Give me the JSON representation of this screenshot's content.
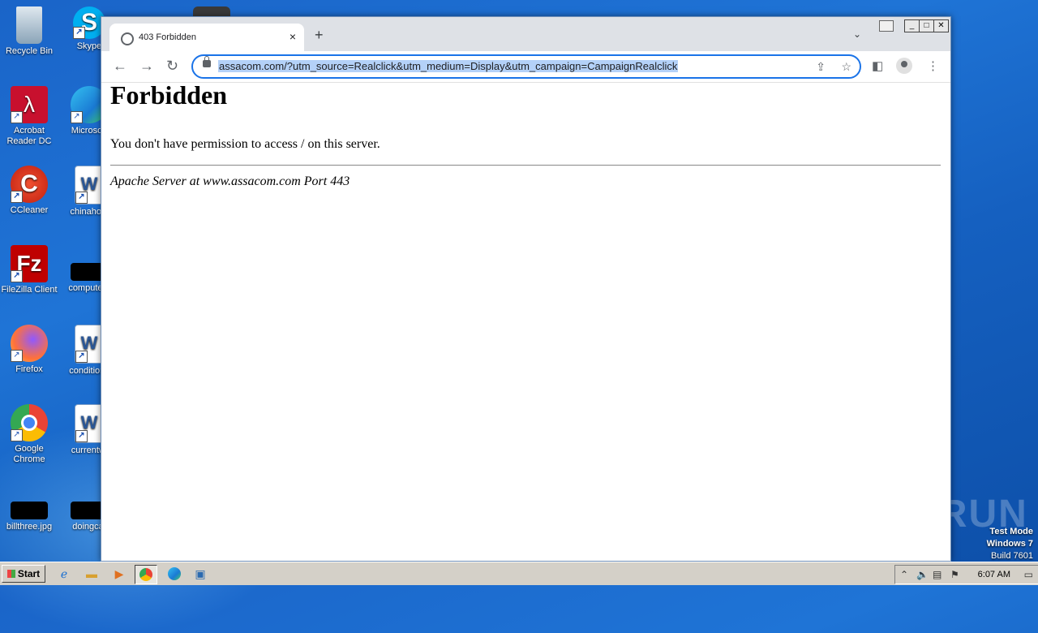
{
  "desktop": {
    "icons": [
      {
        "label": "Recycle Bin"
      },
      {
        "label": "Skype"
      },
      {
        "label": "Acrobat Reader DC"
      },
      {
        "label": "Microsoft"
      },
      {
        "label": "CCleaner"
      },
      {
        "label": "chinahost"
      },
      {
        "label": "FileZilla Client"
      },
      {
        "label": "computers"
      },
      {
        "label": "Firefox"
      },
      {
        "label": "conditions"
      },
      {
        "label": "Google Chrome"
      },
      {
        "label": "currentwi"
      },
      {
        "label": "billthree.jpg"
      },
      {
        "label": "doingcat"
      }
    ],
    "watermark": "ANY RUN",
    "test_mode": {
      "line1": "Test Mode",
      "line2": "Windows 7",
      "line3": "Build 7601"
    }
  },
  "browser": {
    "tab": {
      "title": "403 Forbidden",
      "close": "×"
    },
    "new_tab": "+",
    "tab_search": "⌄",
    "omnibox": {
      "url": "assacom.com/?utm_source=Realclick&utm_medium=Display&utm_campaign=CampaignRealclick"
    },
    "page": {
      "heading": "Forbidden",
      "message": "You don't have permission to access / on this server.",
      "server_signature": "Apache Server at www.assacom.com Port 443"
    }
  },
  "taskbar": {
    "start_label": "Start",
    "clock": "6:07 AM"
  }
}
